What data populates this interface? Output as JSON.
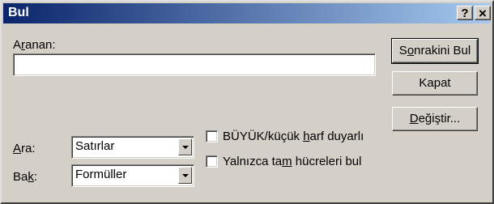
{
  "window": {
    "title": "Bul"
  },
  "titlebar": {
    "help": "?",
    "close": "×"
  },
  "search": {
    "label_prefix": "A",
    "label_ul": "r",
    "label_suffix": "anan:",
    "value": ""
  },
  "buttons": {
    "find_next": {
      "pre": "S",
      "ul": "o",
      "post": "nrakini Bul"
    },
    "close": {
      "pre": "Kapat",
      "ul": "",
      "post": ""
    },
    "replace": {
      "pre": "",
      "ul": "D",
      "post": "eğiştir..."
    }
  },
  "search_order": {
    "label_pre": "",
    "label_ul": "A",
    "label_post": "ra:",
    "value": "Satırlar"
  },
  "look_in": {
    "label_pre": "Ba",
    "label_ul": "k",
    "label_post": ":",
    "value": "Formüller"
  },
  "options": {
    "match_case": {
      "pre": "BÜYÜK/küçük ",
      "ul": "h",
      "post": "arf duyarlı",
      "checked": false
    },
    "whole_cells": {
      "pre": "Yalnızca ta",
      "ul": "m",
      "post": " hücreleri bul",
      "checked": false
    }
  }
}
